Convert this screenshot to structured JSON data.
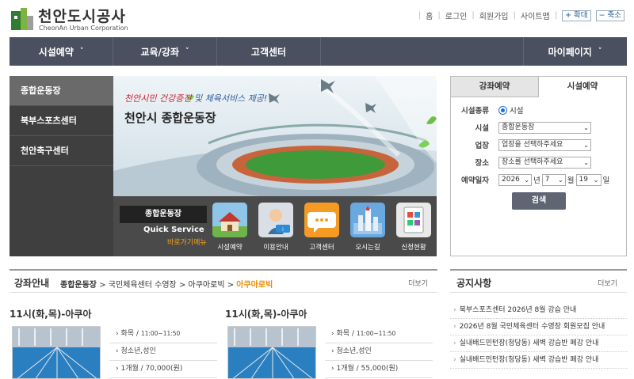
{
  "brand": {
    "name_kr": "천안도시공사",
    "name_en": "CheonAn Urban Corporation"
  },
  "util_nav": {
    "items": [
      "홈",
      "로그인",
      "회원가입",
      "사이트맵"
    ],
    "zoom_in": "+ 확대",
    "zoom_out": "− 축소"
  },
  "gnb": {
    "items": [
      {
        "label": "시설예약",
        "caret": "˅"
      },
      {
        "label": "교육/강좌",
        "caret": "˅"
      },
      {
        "label": "고객센터",
        "caret": ""
      },
      {
        "label": "마이페이지",
        "caret": "˅"
      }
    ]
  },
  "side_menu": {
    "items": [
      {
        "label": "종합운동장",
        "active": true
      },
      {
        "label": "북부스포츠센터",
        "active": false
      },
      {
        "label": "천안축구센터",
        "active": false
      }
    ]
  },
  "visual": {
    "slogan_a": "천안시민 건강증진",
    "slogan_b": " 및 체육서비스 제공!",
    "title": "천안시 종합운동장"
  },
  "quick_service": {
    "facility_name": "종합운동장",
    "label": "Quick Service",
    "sub": "바로가기메뉴",
    "items": [
      {
        "label": "시설예약",
        "icon": "house-icon"
      },
      {
        "label": "이용안내",
        "icon": "info-person-icon"
      },
      {
        "label": "고객센터",
        "icon": "chat-bubble-icon"
      },
      {
        "label": "오시는길",
        "icon": "map-location-icon"
      },
      {
        "label": "신청현황",
        "icon": "document-status-icon"
      }
    ]
  },
  "reservation": {
    "tabs": [
      {
        "label": "강좌예약",
        "active": false
      },
      {
        "label": "시설예약",
        "active": true
      }
    ],
    "type_label": "시설종류",
    "type_option": "시설",
    "facility_label": "시설",
    "facility_value": "종합운동장",
    "venue_label": "업장",
    "venue_value": "업장을 선택하주세요",
    "place_label": "장소",
    "place_value": "장소를 선택하주세요",
    "date_label": "예약일자",
    "year": "2026",
    "year_suffix": "년",
    "month": "7",
    "month_suffix": "월",
    "day": "19",
    "day_suffix": "일",
    "search_label": "검색"
  },
  "course": {
    "title": "강좌안내",
    "crumbs": [
      "종합운동장",
      "국민체육센터 수영장",
      "아쿠아로빅",
      "아쿠아로빅"
    ],
    "crumb_sep": ">",
    "more": "더보기",
    "cards": [
      {
        "title": "11시(화,목)-아쿠아",
        "days": "화목 /",
        "time": "11:00~11:50",
        "target": "청소년,성인",
        "fee": "1개월 / 70,000(원)"
      },
      {
        "title": "11시(화,목)-아쿠아",
        "days": "화목 /",
        "time": "11:00~11:50",
        "target": "청소년,성인",
        "fee": "1개월 / 55,000(원)"
      }
    ]
  },
  "notice": {
    "title": "공지사항",
    "more": "더보기",
    "items": [
      "북부스포츠센터 2026년 8월 강습 안내",
      "2026년 8월 국민체육센터 수영장 회원모집 안내",
      "실내배드민턴장(청당동) 새벽 강습반 폐강 안내",
      "실내배드민턴장(청당동) 새벽 강습반 폐강 안내"
    ]
  },
  "colors": {
    "gnb_bg": "#4a5060",
    "side_bg": "#3f3f3f",
    "accent_orange": "#f08c00",
    "link_blue": "#1a5a9a"
  }
}
